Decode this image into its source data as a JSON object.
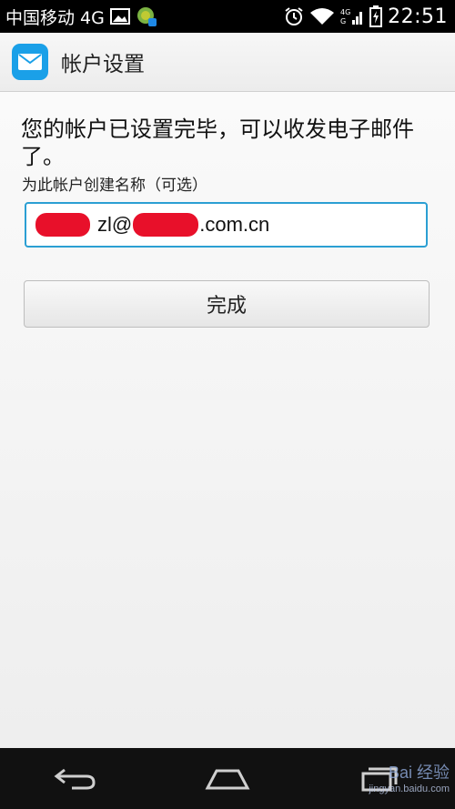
{
  "status_bar": {
    "carrier": "中国移动 4G",
    "signal_labels": "4G",
    "time": "22:51"
  },
  "action_bar": {
    "title": "帐户设置",
    "icon": "mail-icon"
  },
  "main": {
    "message": "您的帐户已设置完毕，可以收发电子邮件了。",
    "name_label": "为此帐户创建名称（可选）",
    "name_value_middle": "zl@",
    "name_value_suffix": ".com.cn",
    "done_label": "完成"
  },
  "nav_bar": {
    "back": "back-icon",
    "home": "home-icon",
    "recent": "recent-apps-icon"
  },
  "watermark": {
    "text": "Bai 经验",
    "url": "jingyan.baidu.com"
  },
  "colors": {
    "accent": "#2b9fd3",
    "app_icon": "#1aa0e8",
    "redaction": "#e8102a"
  }
}
